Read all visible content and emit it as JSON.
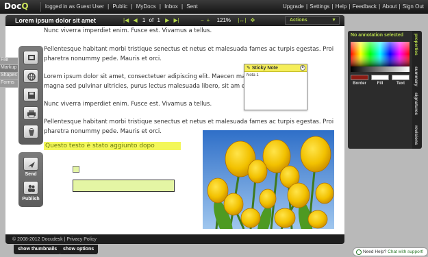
{
  "app": {
    "logo_text": "Doc",
    "logo_accent": "Q",
    "accent_color": "#b6d94a"
  },
  "topnav": {
    "left": [
      "logged in as Guest User",
      "|",
      "Public",
      "|",
      "MyDocs",
      "|",
      "Inbox",
      "|",
      "Sent"
    ],
    "right": [
      "Upgrade",
      "|",
      "Settings",
      "|",
      "Help",
      "|",
      "Feedback",
      "|",
      "About",
      "|",
      "Sign Out"
    ]
  },
  "doc_toolbar": {
    "title": "Lorem ipsum dolor sit amet",
    "page_current": "1",
    "page_of": "of",
    "page_total": "1",
    "zoom_out": "−",
    "zoom_in": "+",
    "zoom_level": "121%",
    "actions_label": "Actions"
  },
  "document": {
    "paragraphs": [
      "Nunc viverra imperdiet enim. Fusce est. Vivamus a tellus.",
      "Pellentesque habitant morbi tristique senectus et netus et malesuada fames ac turpis egestas. Proi",
      "pharetra nonummy pede. Mauris et orci.",
      "Lorem ipsum dolor sit amet, consectetuer adipiscing elit. Maecen                  massa. Fusce",
      "magna sed pulvinar ultricies, purus lectus malesuada libero, sit am                  eros quis ur",
      "Nunc viverra imperdiet enim. Fusce est. Vivamus a tellus.",
      "Pellentesque habitant morbi tristique senectus et netus et malesuada fames ac turpis egestas. Proi",
      "pharetra nonummy pede. Mauris et orci."
    ],
    "highlight_text": "Questo testo è stato aggiunto dopo",
    "footer": "© 2008-2012 Docudesk | Privacy Policy"
  },
  "sticky_note": {
    "title": "Sticky Note",
    "body": "Nota 1",
    "close": "×"
  },
  "side_tabs": [
    "File",
    "Markup",
    "Shapes",
    "Forms"
  ],
  "tools": {
    "send_label": "Send",
    "publish_label": "Publish"
  },
  "bottom_tabs": {
    "thumbnails": "show thumbnails",
    "options": "show options"
  },
  "properties": {
    "title": "No annotation selected",
    "border_label": "Border",
    "fill_label": "Fill",
    "text_label": "Text",
    "border_color": "#8b1a12",
    "fill_color": "#ffffff",
    "text_color": "#ffffff"
  },
  "side_nav": [
    "properties",
    "summary",
    "signatures",
    "revisions"
  ],
  "help": {
    "label": "Need Help?",
    "chat": "Chat with support!"
  }
}
